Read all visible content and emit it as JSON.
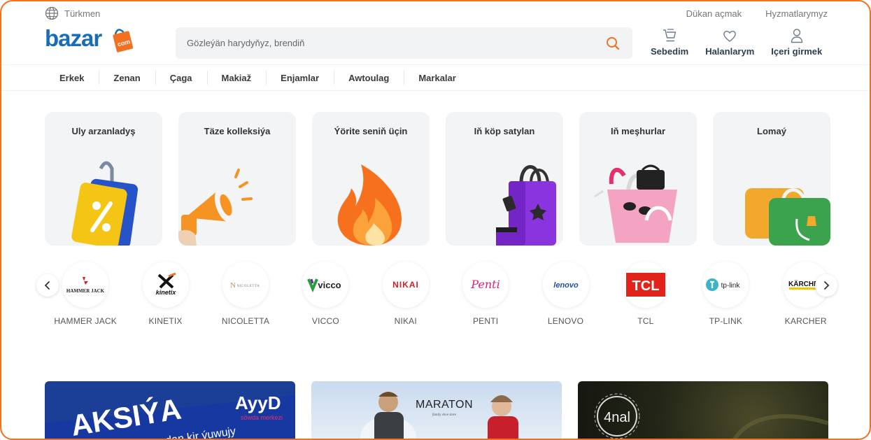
{
  "topbar": {
    "language": "Türkmen",
    "links": [
      "Dükan açmak",
      "Hyzmatlarymyz"
    ]
  },
  "logo": {
    "text": "bazar",
    "badge": "com"
  },
  "search": {
    "placeholder": "Gözleýän harydyňyz, brendiň"
  },
  "actions": [
    {
      "label": "Sebedim",
      "icon": "cart-icon"
    },
    {
      "label": "Halanlarym",
      "icon": "heart-icon"
    },
    {
      "label": "Içeri girmek",
      "icon": "user-icon"
    }
  ],
  "nav": [
    "Erkek",
    "Zenan",
    "Çaga",
    "Makiaž",
    "Enjamlar",
    "Awtoulag",
    "Markalar"
  ],
  "categories": [
    {
      "title": "Uly arzanladyş",
      "icon": "discount-tag-icon"
    },
    {
      "title": "Täze kolleksiýa",
      "icon": "megaphone-icon"
    },
    {
      "title": "Ýörite seniň üçin",
      "icon": "fire-icon"
    },
    {
      "title": "Iň köp satylan",
      "icon": "purple-bag-icon"
    },
    {
      "title": "Iň meşhurlar",
      "icon": "pink-bag-icon"
    },
    {
      "title": "Lomaý",
      "icon": "shopping-bags-icon"
    }
  ],
  "brands": [
    {
      "name": "HAMMER JACK",
      "logo_text": "HAMMER JACK"
    },
    {
      "name": "KINETIX",
      "logo_text": "kinetix"
    },
    {
      "name": "NICOLETTA",
      "logo_text": "NICOLETTA"
    },
    {
      "name": "VICCO",
      "logo_text": "vicco"
    },
    {
      "name": "NIKAI",
      "logo_text": "NIKAI"
    },
    {
      "name": "PENTI",
      "logo_text": "Penti"
    },
    {
      "name": "LENOVO",
      "logo_text": "lenovo"
    },
    {
      "name": "TCL",
      "logo_text": "TCL"
    },
    {
      "name": "TP-LINK",
      "logo_text": "tp-link"
    },
    {
      "name": "KARCHER",
      "logo_text": "KÄRCHER"
    }
  ],
  "banners": [
    {
      "headline": "AKSIÝA",
      "brand": "AyyD",
      "sub": "söwda merkezi",
      "tagline": "...dan kir ýuwujy"
    },
    {
      "brand": "MARATON",
      "sub": "family shoe store"
    },
    {
      "brand": "4nal"
    }
  ],
  "colors": {
    "accent": "#f37021",
    "brand_blue": "#1a6db4",
    "frame": "#f37021"
  }
}
